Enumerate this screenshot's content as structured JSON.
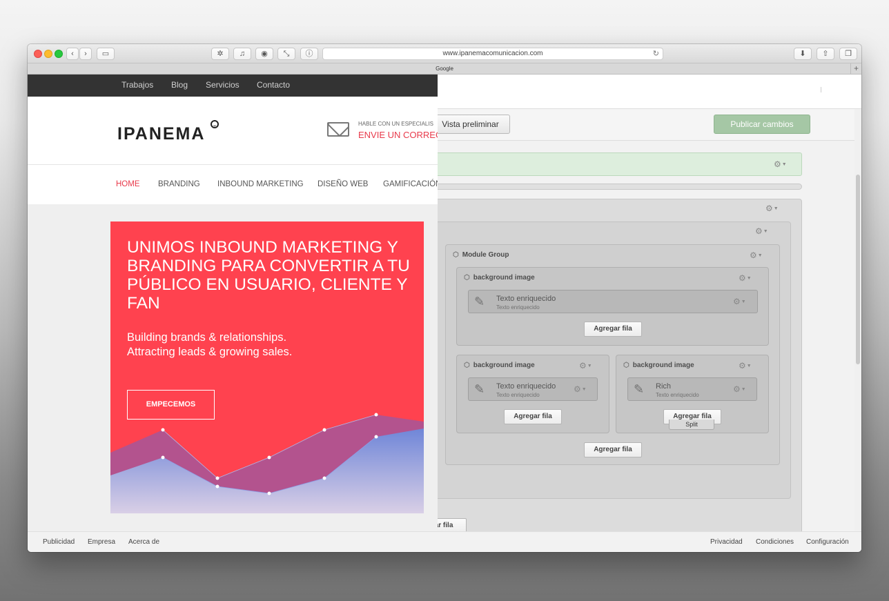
{
  "browser": {
    "url": "www.ipanemacomunicacion.com",
    "tab_title": "Google",
    "new_tab_symbol": "+",
    "reload_symbol": "↻"
  },
  "builder": {
    "preview_label": "Vista preliminar",
    "publish_label": "Publicar cambios",
    "module_group_title": "Module Group",
    "bg_image_title": "background image",
    "rich_text_title": "Texto enriquecido",
    "rich_text_sub": "Texto enriquecido",
    "rich_text_truncated": "Rich",
    "add_row_label": "Agregar fila",
    "add_row_clipped": "gar fila",
    "split_label": "Split",
    "accent_color": "#a5c7a5"
  },
  "site": {
    "top_nav": [
      "Trabajos",
      "Blog",
      "Servicios",
      "Contacto"
    ],
    "logo": "IPANEMA",
    "contact_kicker": "HABLE CON UN ESPECIALIS",
    "contact_cta": "ENVIE UN CORREO",
    "main_nav": [
      "HOME",
      "BRANDING",
      "INBOUND MARKETING",
      "DISEÑO WEB",
      "GAMIFICACIÓN"
    ],
    "hero_title": "UNIMOS INBOUND MARKETING Y BRANDING PARA CONVERTIR A TU PÚBLICO EN USUARIO, CLIENTE Y FAN",
    "hero_sub": "Building brands & relationships.\nAttracting leads & growing sales.",
    "hero_cta": "EMPECEMOS",
    "brand_color": "#ff424f"
  },
  "footer": {
    "left": [
      "Publicidad",
      "Empresa",
      "Acerca de"
    ],
    "right": [
      "Privacidad",
      "Condiciones",
      "Configuración"
    ]
  }
}
